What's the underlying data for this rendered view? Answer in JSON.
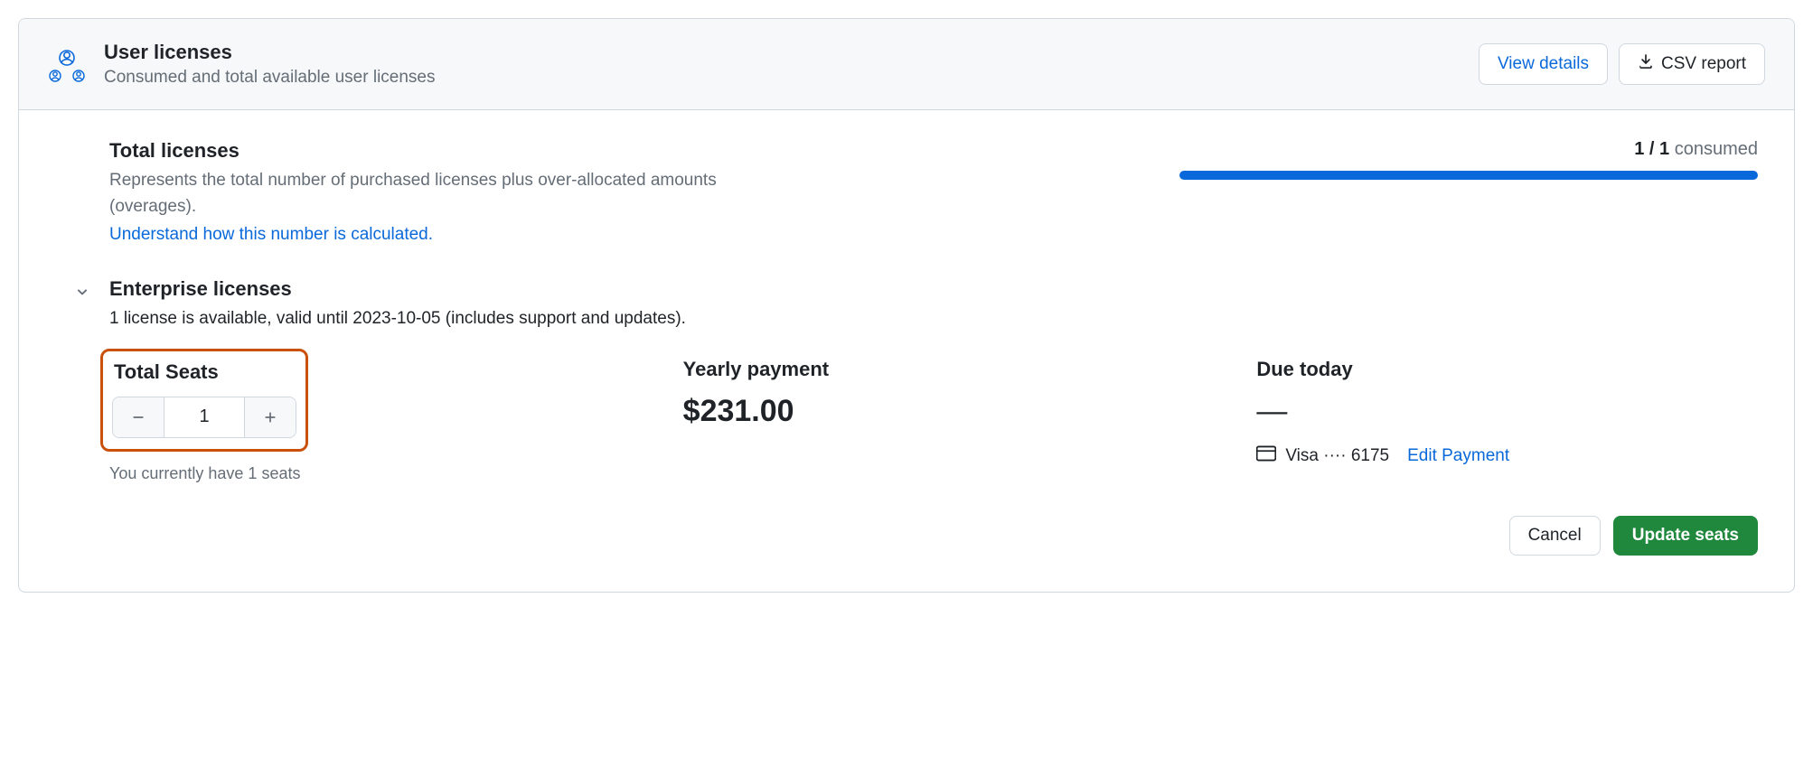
{
  "header": {
    "title": "User licenses",
    "subtitle": "Consumed and total available user licenses",
    "view_details": "View details",
    "csv_report": "CSV report"
  },
  "total_licenses": {
    "title": "Total licenses",
    "desc": "Represents the total number of purchased licenses plus over-allocated amounts (overages).",
    "link": "Understand how this number is calculated.",
    "consumed_prefix": "1 / 1",
    "consumed_suffix": " consumed"
  },
  "enterprise": {
    "title": "Enterprise licenses",
    "desc": "1 license is available, valid until 2023-10-05 (includes support and updates)."
  },
  "seats": {
    "label": "Total Seats",
    "value": "1",
    "hint": "You currently have 1 seats"
  },
  "yearly": {
    "label": "Yearly payment",
    "value": "$231.00"
  },
  "due": {
    "label": "Due today",
    "value": "—",
    "card": "Visa ···· 6175",
    "edit": "Edit Payment"
  },
  "actions": {
    "cancel": "Cancel",
    "update": "Update seats"
  }
}
